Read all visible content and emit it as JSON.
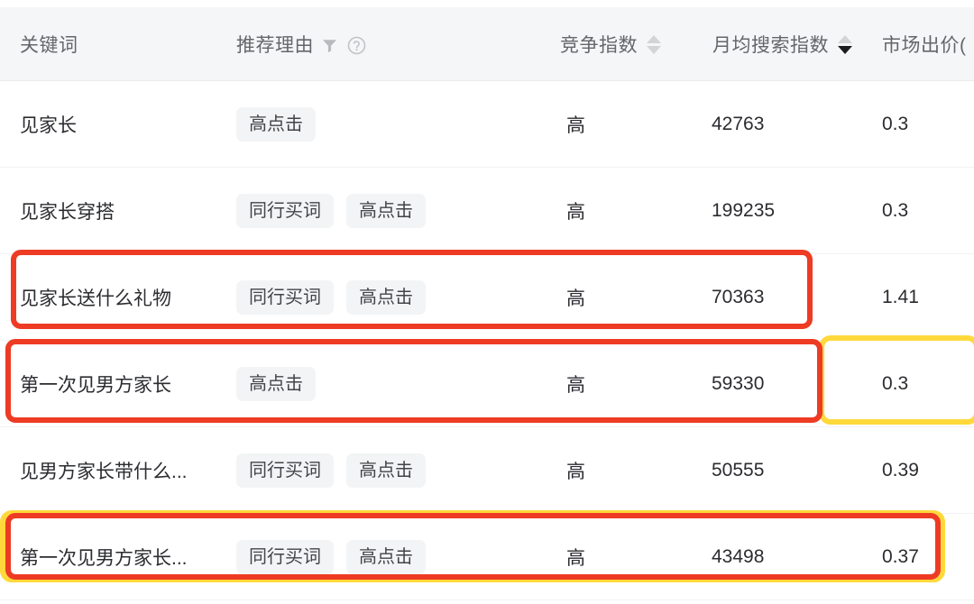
{
  "table": {
    "columns": [
      {
        "key": "keyword",
        "label": "关键词",
        "has_filter": false,
        "has_help": false,
        "sort": "none"
      },
      {
        "key": "reason",
        "label": "推荐理由",
        "has_filter": true,
        "has_help": true,
        "sort": "none"
      },
      {
        "key": "compete",
        "label": "竞争指数",
        "has_filter": false,
        "has_help": false,
        "sort": "none"
      },
      {
        "key": "search",
        "label": "月均搜索指数",
        "has_filter": false,
        "has_help": false,
        "sort": "desc"
      },
      {
        "key": "price",
        "label": "市场出价(",
        "has_filter": false,
        "has_help": false,
        "sort": "none"
      }
    ],
    "icons": {
      "filter": "filter-icon",
      "help": "help-circle-icon",
      "sort_up": "sort-ascending-arrow",
      "sort_down": "sort-descending-arrow"
    },
    "rows": [
      {
        "keyword": "见家长",
        "tags": [
          "高点击"
        ],
        "compete": "高",
        "search": "42763",
        "price": "0.3"
      },
      {
        "keyword": "见家长穿搭",
        "tags": [
          "同行买词",
          "高点击"
        ],
        "compete": "高",
        "search": "199235",
        "price": "0.3"
      },
      {
        "keyword": "见家长送什么礼物",
        "tags": [
          "同行买词",
          "高点击"
        ],
        "compete": "高",
        "search": "70363",
        "price": "1.41"
      },
      {
        "keyword": "第一次见男方家长",
        "tags": [
          "高点击"
        ],
        "compete": "高",
        "search": "59330",
        "price": "0.3"
      },
      {
        "keyword": "见男方家长带什么...",
        "tags": [
          "同行买词",
          "高点击"
        ],
        "compete": "高",
        "search": "50555",
        "price": "0.39"
      },
      {
        "keyword": "第一次见男方家长...",
        "tags": [
          "同行买词",
          "高点击"
        ],
        "compete": "高",
        "search": "43498",
        "price": "0.37"
      }
    ]
  },
  "annotations": {
    "red_color": "#ee3b23",
    "yellow_color": "#ffd93b",
    "boxes": [
      {
        "name": "red-highlight-row-3",
        "color": "red"
      },
      {
        "name": "red-highlight-row-4",
        "color": "red"
      },
      {
        "name": "yellow-highlight-row-4-price",
        "color": "yellow"
      },
      {
        "name": "yellow-highlight-row-6",
        "color": "yellow"
      },
      {
        "name": "red-highlight-row-6",
        "color": "red"
      }
    ]
  }
}
